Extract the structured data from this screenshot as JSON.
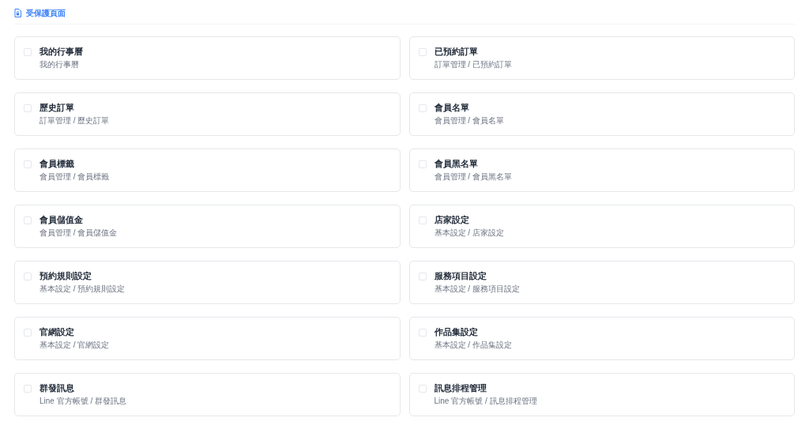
{
  "header": {
    "title": "受保護頁面"
  },
  "pages": [
    {
      "title": "我的行事曆",
      "path": "我的行事曆",
      "checked": false
    },
    {
      "title": "已預約訂單",
      "path": "訂單管理 / 已預約訂單",
      "checked": false
    },
    {
      "title": "歷史訂單",
      "path": "訂單管理 / 歷史訂單",
      "checked": false
    },
    {
      "title": "會員名單",
      "path": "會員管理 / 會員名單",
      "checked": false
    },
    {
      "title": "會員標籤",
      "path": "會員管理 / 會員標籤",
      "checked": false
    },
    {
      "title": "會員黑名單",
      "path": "會員管理 / 會員黑名單",
      "checked": false
    },
    {
      "title": "會員儲值金",
      "path": "會員管理 / 會員儲值金",
      "checked": false
    },
    {
      "title": "店家設定",
      "path": "基本設定 / 店家設定",
      "checked": false
    },
    {
      "title": "預約規則設定",
      "path": "基本設定 / 預約規則設定",
      "checked": false
    },
    {
      "title": "服務項目設定",
      "path": "基本設定 / 服務項目設定",
      "checked": false
    },
    {
      "title": "官網設定",
      "path": "基本設定 / 官網設定",
      "checked": false
    },
    {
      "title": "作品集設定",
      "path": "基本設定 / 作品集設定",
      "checked": false
    },
    {
      "title": "群發訊息",
      "path": "Line 官方帳號 / 群發訊息",
      "checked": false
    },
    {
      "title": "訊息排程管理",
      "path": "Line 官方帳號 / 訊息排程管理",
      "checked": false
    }
  ]
}
